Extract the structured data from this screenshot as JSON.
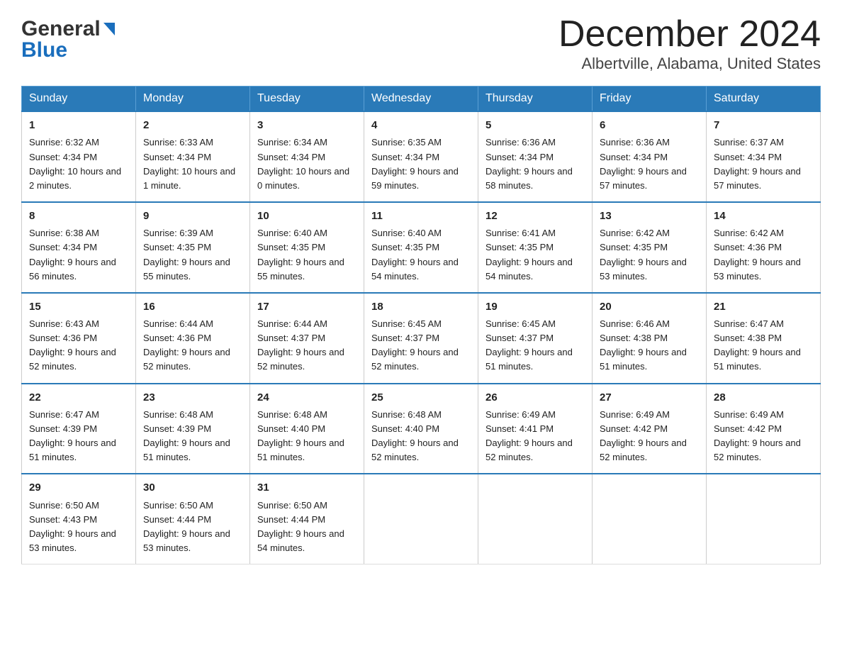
{
  "header": {
    "title": "December 2024",
    "subtitle": "Albertville, Alabama, United States",
    "logo_general": "General",
    "logo_blue": "Blue"
  },
  "days_of_week": [
    "Sunday",
    "Monday",
    "Tuesday",
    "Wednesday",
    "Thursday",
    "Friday",
    "Saturday"
  ],
  "weeks": [
    [
      {
        "day": "1",
        "sunrise": "Sunrise: 6:32 AM",
        "sunset": "Sunset: 4:34 PM",
        "daylight": "Daylight: 10 hours and 2 minutes."
      },
      {
        "day": "2",
        "sunrise": "Sunrise: 6:33 AM",
        "sunset": "Sunset: 4:34 PM",
        "daylight": "Daylight: 10 hours and 1 minute."
      },
      {
        "day": "3",
        "sunrise": "Sunrise: 6:34 AM",
        "sunset": "Sunset: 4:34 PM",
        "daylight": "Daylight: 10 hours and 0 minutes."
      },
      {
        "day": "4",
        "sunrise": "Sunrise: 6:35 AM",
        "sunset": "Sunset: 4:34 PM",
        "daylight": "Daylight: 9 hours and 59 minutes."
      },
      {
        "day": "5",
        "sunrise": "Sunrise: 6:36 AM",
        "sunset": "Sunset: 4:34 PM",
        "daylight": "Daylight: 9 hours and 58 minutes."
      },
      {
        "day": "6",
        "sunrise": "Sunrise: 6:36 AM",
        "sunset": "Sunset: 4:34 PM",
        "daylight": "Daylight: 9 hours and 57 minutes."
      },
      {
        "day": "7",
        "sunrise": "Sunrise: 6:37 AM",
        "sunset": "Sunset: 4:34 PM",
        "daylight": "Daylight: 9 hours and 57 minutes."
      }
    ],
    [
      {
        "day": "8",
        "sunrise": "Sunrise: 6:38 AM",
        "sunset": "Sunset: 4:34 PM",
        "daylight": "Daylight: 9 hours and 56 minutes."
      },
      {
        "day": "9",
        "sunrise": "Sunrise: 6:39 AM",
        "sunset": "Sunset: 4:35 PM",
        "daylight": "Daylight: 9 hours and 55 minutes."
      },
      {
        "day": "10",
        "sunrise": "Sunrise: 6:40 AM",
        "sunset": "Sunset: 4:35 PM",
        "daylight": "Daylight: 9 hours and 55 minutes."
      },
      {
        "day": "11",
        "sunrise": "Sunrise: 6:40 AM",
        "sunset": "Sunset: 4:35 PM",
        "daylight": "Daylight: 9 hours and 54 minutes."
      },
      {
        "day": "12",
        "sunrise": "Sunrise: 6:41 AM",
        "sunset": "Sunset: 4:35 PM",
        "daylight": "Daylight: 9 hours and 54 minutes."
      },
      {
        "day": "13",
        "sunrise": "Sunrise: 6:42 AM",
        "sunset": "Sunset: 4:35 PM",
        "daylight": "Daylight: 9 hours and 53 minutes."
      },
      {
        "day": "14",
        "sunrise": "Sunrise: 6:42 AM",
        "sunset": "Sunset: 4:36 PM",
        "daylight": "Daylight: 9 hours and 53 minutes."
      }
    ],
    [
      {
        "day": "15",
        "sunrise": "Sunrise: 6:43 AM",
        "sunset": "Sunset: 4:36 PM",
        "daylight": "Daylight: 9 hours and 52 minutes."
      },
      {
        "day": "16",
        "sunrise": "Sunrise: 6:44 AM",
        "sunset": "Sunset: 4:36 PM",
        "daylight": "Daylight: 9 hours and 52 minutes."
      },
      {
        "day": "17",
        "sunrise": "Sunrise: 6:44 AM",
        "sunset": "Sunset: 4:37 PM",
        "daylight": "Daylight: 9 hours and 52 minutes."
      },
      {
        "day": "18",
        "sunrise": "Sunrise: 6:45 AM",
        "sunset": "Sunset: 4:37 PM",
        "daylight": "Daylight: 9 hours and 52 minutes."
      },
      {
        "day": "19",
        "sunrise": "Sunrise: 6:45 AM",
        "sunset": "Sunset: 4:37 PM",
        "daylight": "Daylight: 9 hours and 51 minutes."
      },
      {
        "day": "20",
        "sunrise": "Sunrise: 6:46 AM",
        "sunset": "Sunset: 4:38 PM",
        "daylight": "Daylight: 9 hours and 51 minutes."
      },
      {
        "day": "21",
        "sunrise": "Sunrise: 6:47 AM",
        "sunset": "Sunset: 4:38 PM",
        "daylight": "Daylight: 9 hours and 51 minutes."
      }
    ],
    [
      {
        "day": "22",
        "sunrise": "Sunrise: 6:47 AM",
        "sunset": "Sunset: 4:39 PM",
        "daylight": "Daylight: 9 hours and 51 minutes."
      },
      {
        "day": "23",
        "sunrise": "Sunrise: 6:48 AM",
        "sunset": "Sunset: 4:39 PM",
        "daylight": "Daylight: 9 hours and 51 minutes."
      },
      {
        "day": "24",
        "sunrise": "Sunrise: 6:48 AM",
        "sunset": "Sunset: 4:40 PM",
        "daylight": "Daylight: 9 hours and 51 minutes."
      },
      {
        "day": "25",
        "sunrise": "Sunrise: 6:48 AM",
        "sunset": "Sunset: 4:40 PM",
        "daylight": "Daylight: 9 hours and 52 minutes."
      },
      {
        "day": "26",
        "sunrise": "Sunrise: 6:49 AM",
        "sunset": "Sunset: 4:41 PM",
        "daylight": "Daylight: 9 hours and 52 minutes."
      },
      {
        "day": "27",
        "sunrise": "Sunrise: 6:49 AM",
        "sunset": "Sunset: 4:42 PM",
        "daylight": "Daylight: 9 hours and 52 minutes."
      },
      {
        "day": "28",
        "sunrise": "Sunrise: 6:49 AM",
        "sunset": "Sunset: 4:42 PM",
        "daylight": "Daylight: 9 hours and 52 minutes."
      }
    ],
    [
      {
        "day": "29",
        "sunrise": "Sunrise: 6:50 AM",
        "sunset": "Sunset: 4:43 PM",
        "daylight": "Daylight: 9 hours and 53 minutes."
      },
      {
        "day": "30",
        "sunrise": "Sunrise: 6:50 AM",
        "sunset": "Sunset: 4:44 PM",
        "daylight": "Daylight: 9 hours and 53 minutes."
      },
      {
        "day": "31",
        "sunrise": "Sunrise: 6:50 AM",
        "sunset": "Sunset: 4:44 PM",
        "daylight": "Daylight: 9 hours and 54 minutes."
      },
      null,
      null,
      null,
      null
    ]
  ]
}
